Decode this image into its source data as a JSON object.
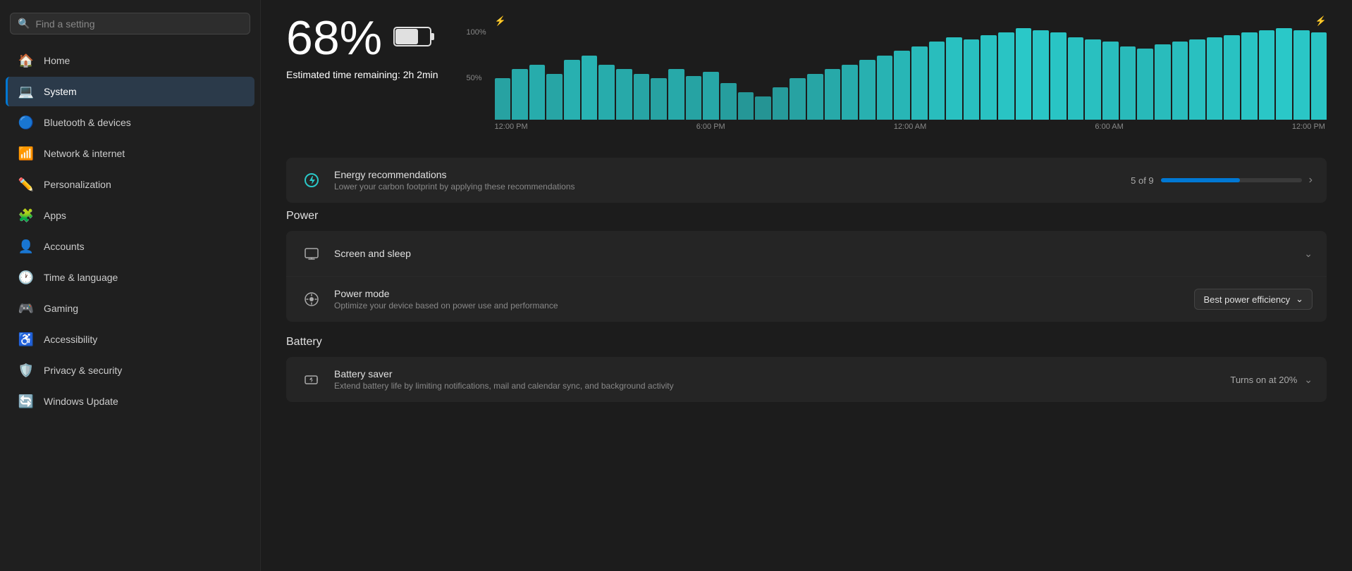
{
  "sidebar": {
    "search_placeholder": "Find a setting",
    "items": [
      {
        "id": "home",
        "label": "Home",
        "icon": "🏠",
        "active": false
      },
      {
        "id": "system",
        "label": "System",
        "icon": "💻",
        "active": true
      },
      {
        "id": "bluetooth",
        "label": "Bluetooth & devices",
        "icon": "🔵",
        "active": false
      },
      {
        "id": "network",
        "label": "Network & internet",
        "icon": "📶",
        "active": false
      },
      {
        "id": "personalization",
        "label": "Personalization",
        "icon": "✏️",
        "active": false
      },
      {
        "id": "apps",
        "label": "Apps",
        "icon": "🧩",
        "active": false
      },
      {
        "id": "accounts",
        "label": "Accounts",
        "icon": "👤",
        "active": false
      },
      {
        "id": "time",
        "label": "Time & language",
        "icon": "🕐",
        "active": false
      },
      {
        "id": "gaming",
        "label": "Gaming",
        "icon": "🎮",
        "active": false
      },
      {
        "id": "accessibility",
        "label": "Accessibility",
        "icon": "♿",
        "active": false
      },
      {
        "id": "privacy",
        "label": "Privacy & security",
        "icon": "🛡️",
        "active": false
      },
      {
        "id": "update",
        "label": "Windows Update",
        "icon": "🔄",
        "active": false
      }
    ]
  },
  "main": {
    "battery_percent": "68%",
    "estimated_label": "Estimated time remaining:",
    "estimated_value": "2h 2min",
    "chart": {
      "y_labels": [
        "100%",
        "50%"
      ],
      "x_labels": [
        "12:00 PM",
        "6:00 PM",
        "12:00 AM",
        "6:00 AM",
        "12:00 PM"
      ],
      "bars": [
        45,
        55,
        60,
        50,
        65,
        70,
        60,
        55,
        50,
        45,
        55,
        48,
        52,
        40,
        30,
        25,
        35,
        45,
        50,
        55,
        60,
        65,
        70,
        75,
        80,
        85,
        90,
        88,
        92,
        95,
        100,
        98,
        95,
        90,
        88,
        85,
        80,
        78,
        82,
        85,
        88,
        90,
        92,
        95,
        98,
        100,
        98,
        95
      ],
      "charging_indices": [
        0,
        1,
        30,
        31,
        46,
        47
      ]
    },
    "energy_section": {
      "title": "Energy recommendations",
      "subtitle": "Lower your carbon footprint by applying these recommendations",
      "progress_text": "5 of 9",
      "progress_pct": 56
    },
    "power_section": {
      "title": "Power",
      "screen_sleep": {
        "title": "Screen and sleep",
        "icon": "🖥️"
      },
      "power_mode": {
        "title": "Power mode",
        "subtitle": "Optimize your device based on power use and performance",
        "icon": "⚙️",
        "current_value": "Best power efficiency"
      }
    },
    "battery_section": {
      "title": "Battery",
      "battery_saver": {
        "title": "Battery saver",
        "subtitle": "Extend battery life by limiting notifications, mail and calendar sync, and background activity",
        "icon": "🔋",
        "right_text": "Turns on at 20%"
      }
    }
  }
}
